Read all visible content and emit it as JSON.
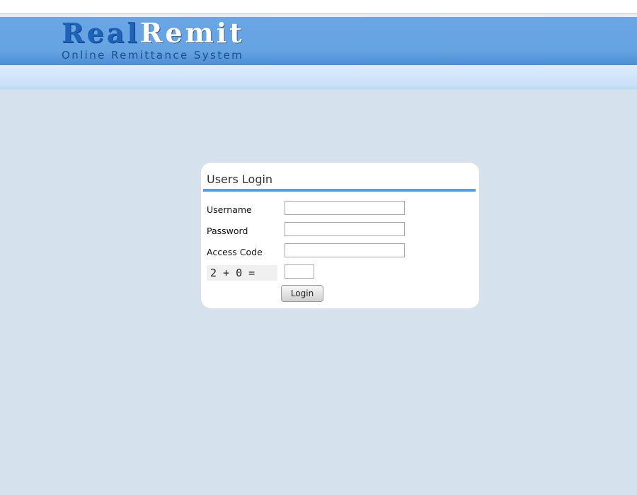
{
  "header": {
    "logo_part1": "Real",
    "logo_part2": "Remit",
    "tagline": "Online Remittance System"
  },
  "login": {
    "title": "Users Login",
    "username_label": "Username",
    "username_value": "",
    "password_label": "Password",
    "password_value": "",
    "access_code_label": "Access Code",
    "access_code_value": "",
    "captcha_question": "2 + 0 =",
    "captcha_value": "",
    "login_button_label": "Login"
  },
  "colors": {
    "page_background": "#d5e2ee",
    "header_blue": "#66a3e2",
    "logo_dark_blue": "#1e63b8",
    "nav_bar": "#cfe4fa",
    "title_rule": "#5b9ddd",
    "card_background": "#ffffff"
  }
}
